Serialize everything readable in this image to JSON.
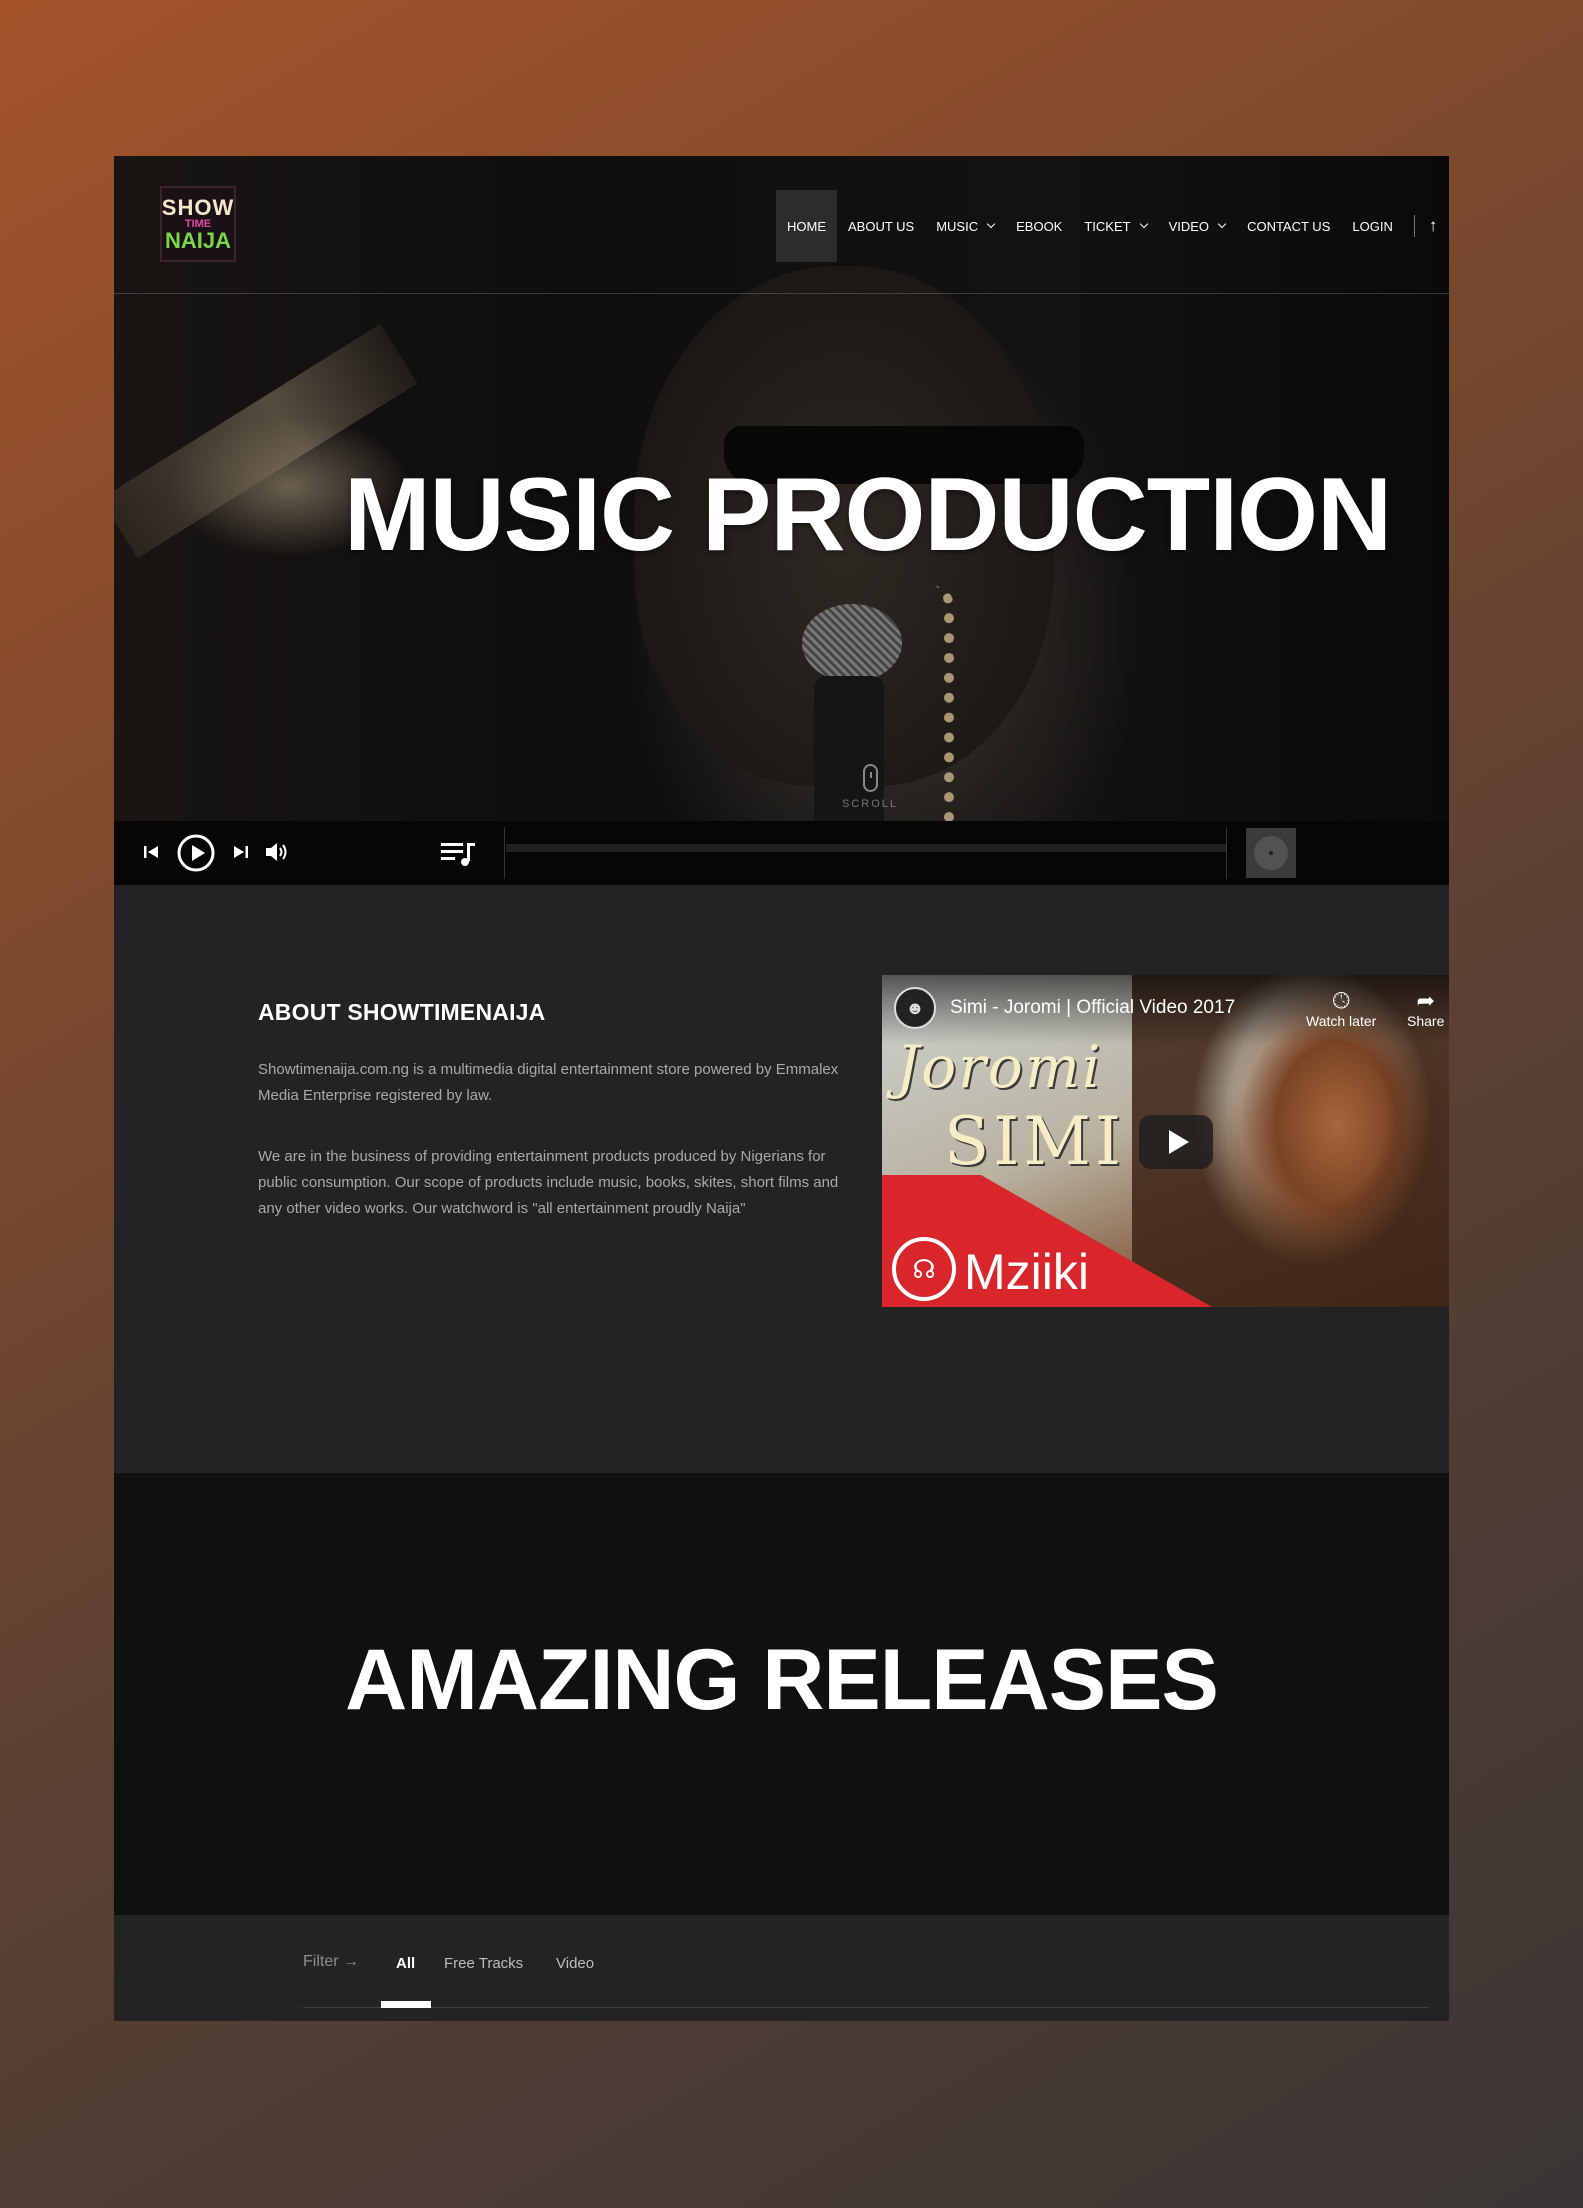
{
  "logo": {
    "line1": "SHOW",
    "line2": "TIME",
    "line3": "NAIJA"
  },
  "nav": {
    "items": [
      {
        "label": "HOME",
        "active": true
      },
      {
        "label": "ABOUT US"
      },
      {
        "label": "MUSIC",
        "dropdown": true
      },
      {
        "label": "EBOOK"
      },
      {
        "label": "TICKET",
        "dropdown": true
      },
      {
        "label": "VIDEO",
        "dropdown": true
      },
      {
        "label": "CONTACT US"
      },
      {
        "label": "LOGIN"
      }
    ],
    "scroll_top_icon": "arrow-up-icon"
  },
  "hero": {
    "title": "MUSIC PRODUCTION",
    "scroll_label": "SCROLL"
  },
  "player": {
    "icons": [
      "skip-back-icon",
      "play-circle-icon",
      "skip-forward-icon",
      "volume-icon",
      "playlist-icon",
      "album-art-icon"
    ],
    "progress": 0
  },
  "about": {
    "title": "ABOUT SHOWTIMENAIJA",
    "p1": "Showtimenaija.com.ng is a multimedia digital entertainment store powered by Emmalex Media Enterprise registered by law.",
    "p2": "We are in the business of providing entertainment products produced by Nigerians for public consumption. Our scope of products include music, books, skites, short films and any other video works. Our watchword is \"all entertainment proudly Naija\""
  },
  "video": {
    "title": "Simi - Joromi | Official Video 2017",
    "watch_later": "Watch later",
    "share": "Share",
    "art_line1": "Joromi",
    "art_line2": "SIMI",
    "brand": "Mziiki"
  },
  "releases": {
    "title": "AMAZING RELEASES"
  },
  "filter": {
    "label": "Filter →",
    "tabs": [
      {
        "label": "All",
        "active": true
      },
      {
        "label": "Free Tracks"
      },
      {
        "label": "Video"
      }
    ]
  }
}
